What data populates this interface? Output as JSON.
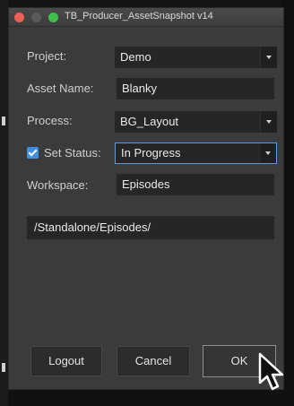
{
  "window": {
    "title": "TB_Producer_AssetSnapshot v14"
  },
  "form": {
    "project_label": "Project:",
    "project_value": "Demo",
    "asset_name_label": "Asset Name:",
    "asset_name_value": "Blanky",
    "process_label": "Process:",
    "process_value": "BG_Layout",
    "set_status_label": "Set Status:",
    "set_status_checked": true,
    "status_value": "In Progress",
    "workspace_label": "Workspace:",
    "workspace_value": "Episodes",
    "path_value": "/Standalone/Episodes/"
  },
  "buttons": {
    "logout": "Logout",
    "cancel": "Cancel",
    "ok": "OK"
  },
  "colors": {
    "accent": "#3d8fe0",
    "window_bg": "#3b3b3b",
    "field_bg": "#262626"
  },
  "icons": [
    "close-icon",
    "minimize-icon",
    "maximize-icon",
    "checkmark-icon",
    "chevron-down-icon",
    "mouse-pointer-icon"
  ]
}
